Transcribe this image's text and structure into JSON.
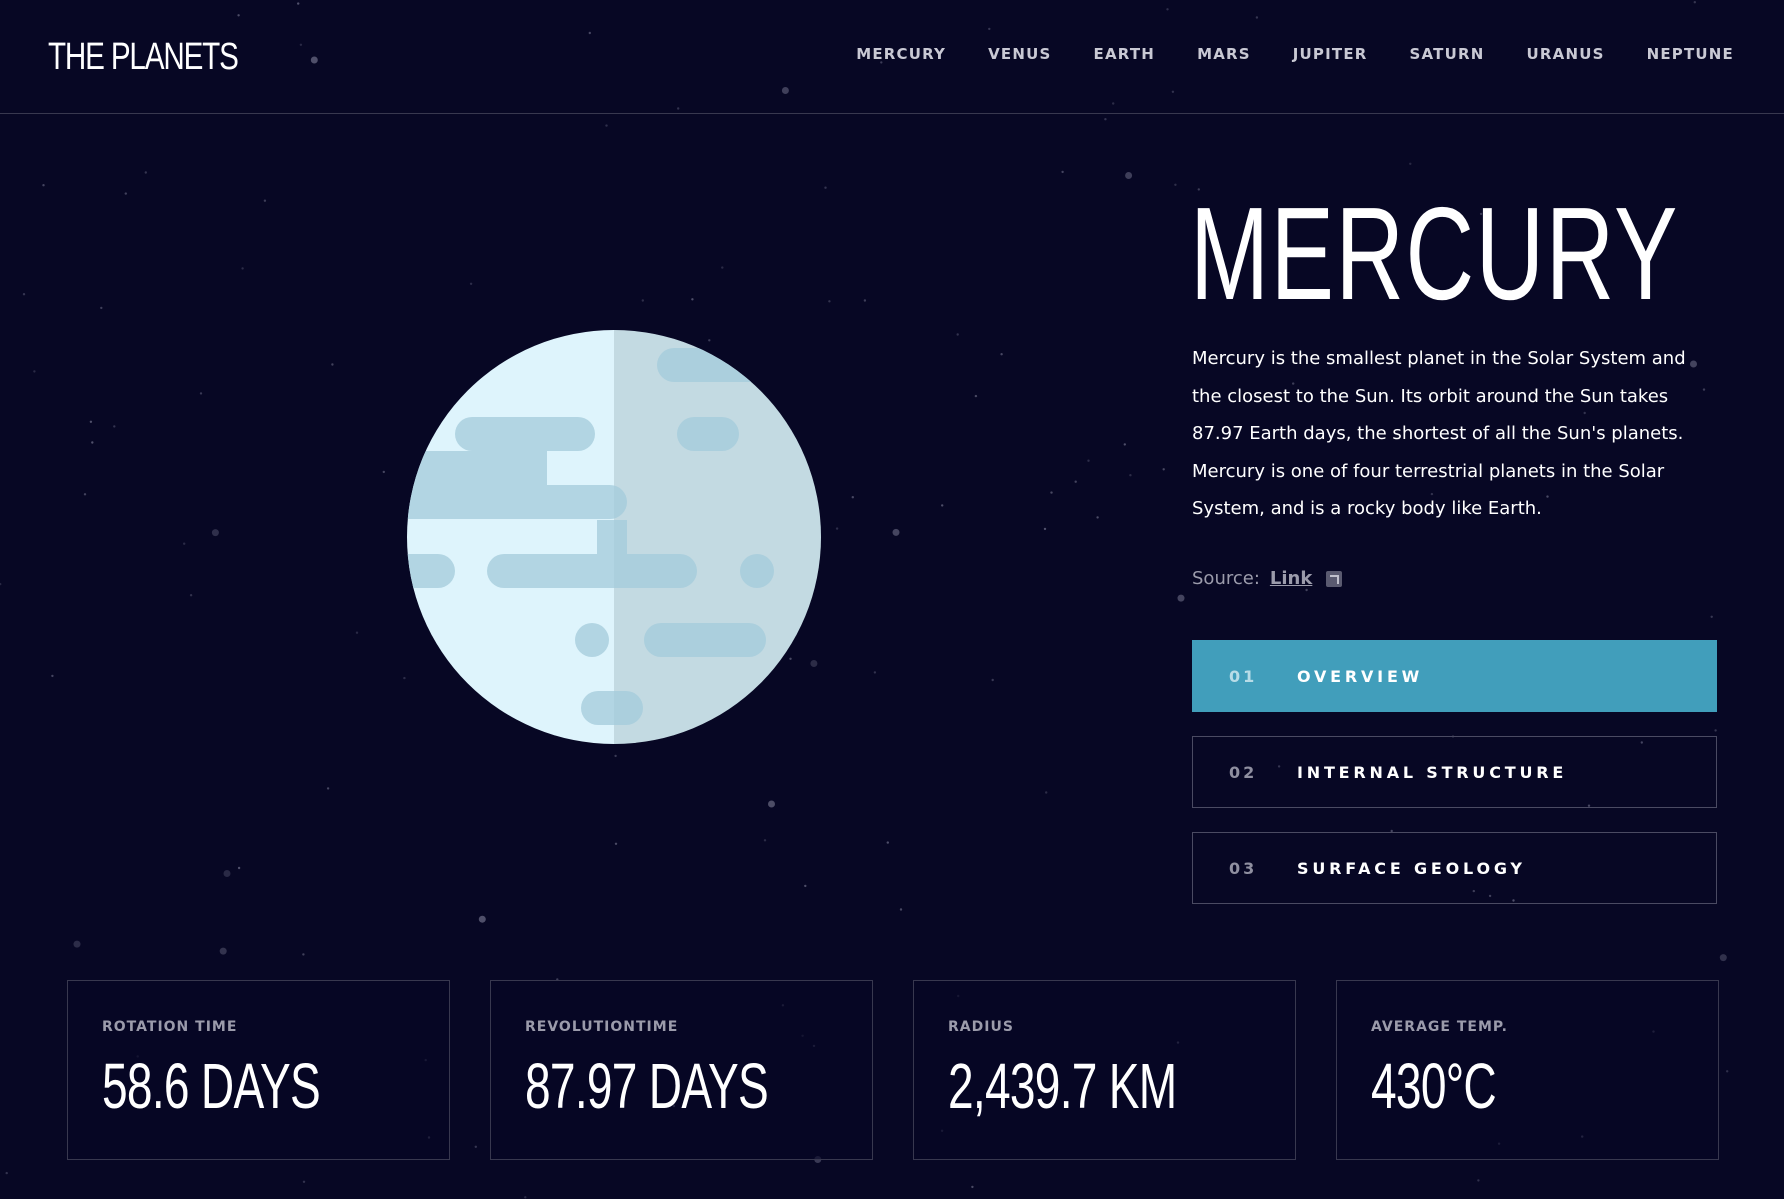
{
  "header": {
    "logo": "THE PLANETS",
    "nav": [
      "MERCURY",
      "VENUS",
      "EARTH",
      "MARS",
      "JUPITER",
      "SATURN",
      "URANUS",
      "NEPTUNE"
    ]
  },
  "planet": {
    "name": "MERCURY",
    "description": "Mercury is the smallest planet in the Solar System and the closest to the Sun. Its orbit around the Sun takes 87.97 Earth days, the shortest of all the Sun's planets. Mercury is one of four terrestrial planets in the Solar System, and is a rocky body like Earth.",
    "source_label": "Source:",
    "source_link": "Link",
    "icon": "external-link-icon"
  },
  "tabs": [
    {
      "num": "01",
      "label": "OVERVIEW",
      "active": true
    },
    {
      "num": "02",
      "label": "INTERNAL STRUCTURE",
      "active": false
    },
    {
      "num": "03",
      "label": "SURFACE GEOLOGY",
      "active": false
    }
  ],
  "stats": [
    {
      "label": "ROTATION TIME",
      "value": "58.6 DAYS"
    },
    {
      "label": "REVOLUTIONTIME",
      "value": "87.97 DAYS"
    },
    {
      "label": "RADIUS",
      "value": "2,439.7 KM"
    },
    {
      "label": "AVERAGE TEMP.",
      "value": "430°C"
    }
  ],
  "colors": {
    "background": "#070724",
    "accent": "#419ebb",
    "border": "#38384f",
    "planet_light": "#def4fc",
    "planet_dark": "#cde2e9",
    "planet_spots": "#b2d5e3"
  }
}
